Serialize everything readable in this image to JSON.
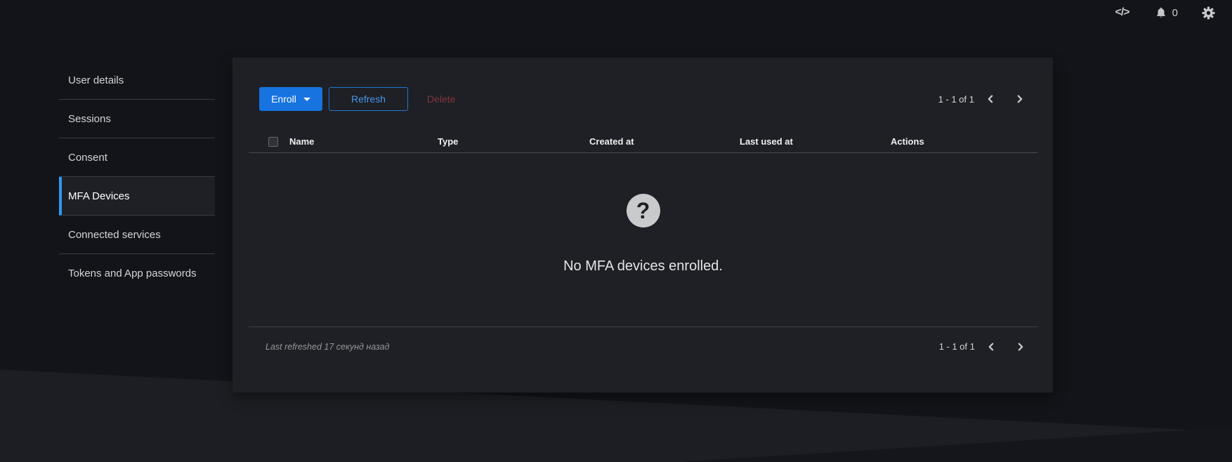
{
  "topbar": {
    "notification_count": "0"
  },
  "sidebar": {
    "items": [
      {
        "label": "User details"
      },
      {
        "label": "Sessions"
      },
      {
        "label": "Consent"
      },
      {
        "label": "MFA Devices",
        "active": true
      },
      {
        "label": "Connected services"
      },
      {
        "label": "Tokens and App passwords"
      }
    ]
  },
  "main": {
    "toolbar": {
      "enroll_label": "Enroll",
      "refresh_label": "Refresh",
      "delete_label": "Delete"
    },
    "pagination": {
      "range_label": "1 - 1 of 1"
    },
    "table": {
      "headers": [
        "Name",
        "Type",
        "Created at",
        "Last used at",
        "Actions"
      ]
    },
    "empty_state": {
      "message": "No MFA devices enrolled."
    },
    "footer": {
      "last_refreshed_label": "Last refreshed 17 секунд назад"
    }
  },
  "colors": {
    "page_background": "#131419",
    "card_background": "#1e2025",
    "accent_blue": "#1673e0",
    "active_indicator_blue": "#2b9af3",
    "refresh_blue": "#4a95ea",
    "delete_disabled_red": "#82353d"
  }
}
